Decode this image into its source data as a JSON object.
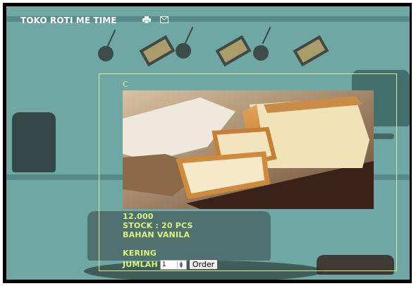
{
  "nav": {
    "brand": "TOKO ROTI ME TIME",
    "icons": [
      "print-icon",
      "mail-icon"
    ]
  },
  "product": {
    "title": "C",
    "price": "12.000",
    "stock": "STOCK : 20 PCS",
    "material": "BAHAN VANILA",
    "type": "KERING",
    "qty_label": "JUMLAH",
    "qty_value": "1",
    "order_label": "Order"
  },
  "colors": {
    "accent_text": "#d8f57c",
    "card_border": "#d9f08a",
    "background": "#6ea7a3"
  }
}
